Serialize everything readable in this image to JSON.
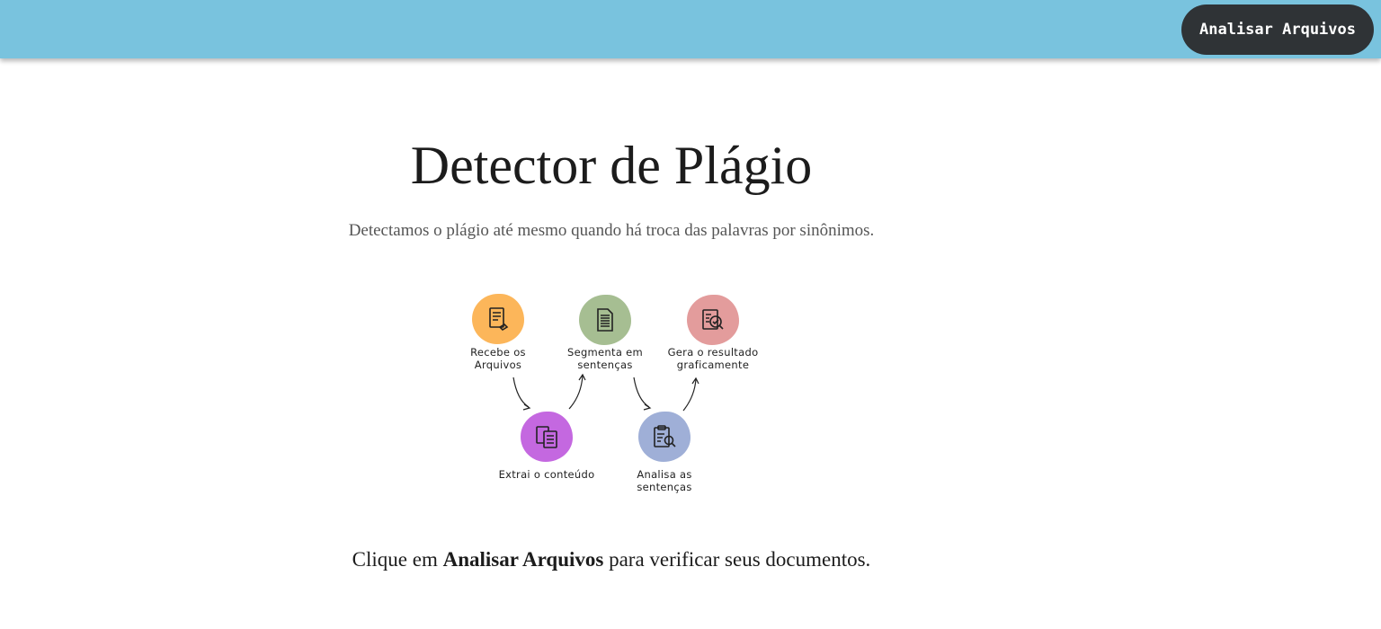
{
  "header": {
    "analyze_button": "Analisar Arquivos"
  },
  "hero": {
    "title": "Detector de Plágio",
    "subtitle": "Detectamos o plágio até mesmo quando há troca das palavras por sinônimos."
  },
  "flow": {
    "steps": [
      {
        "label": "Recebe os\nArquivos",
        "color": "#fcb65a",
        "icon": "document-receive-icon"
      },
      {
        "label": "Extrai o conteúdo",
        "color": "#c468e0",
        "icon": "documents-extract-icon"
      },
      {
        "label": "Segmenta em\nsentenças",
        "color": "#a6be92",
        "icon": "document-lines-icon"
      },
      {
        "label": "Analisa as\nsentenças",
        "color": "#9fafd7",
        "icon": "clipboard-search-icon"
      },
      {
        "label": "Gera o resultado\ngraficamente",
        "color": "#e39c9c",
        "icon": "report-check-icon"
      }
    ]
  },
  "cta": {
    "prefix": "Clique em ",
    "bold": "Analisar Arquivos",
    "suffix": " para verificar seus documentos."
  }
}
